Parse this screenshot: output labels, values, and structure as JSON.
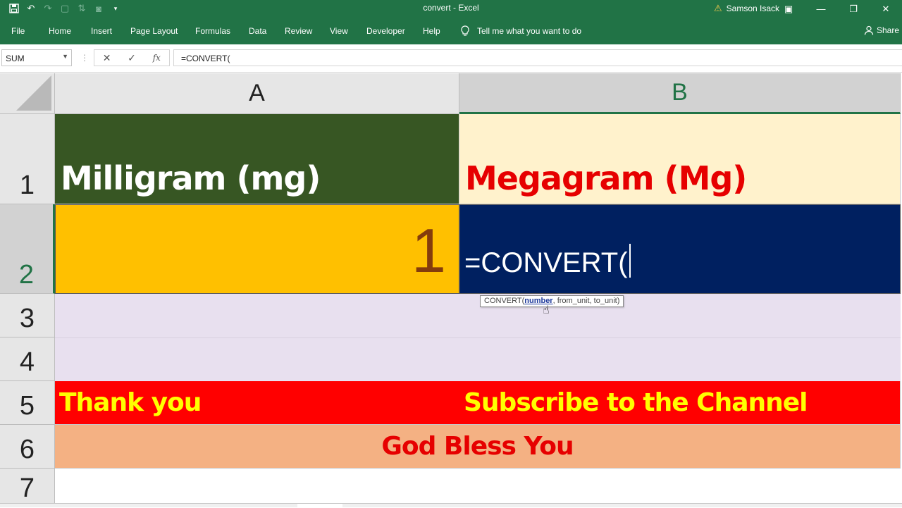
{
  "window": {
    "title": "convert  -  Excel",
    "user": "Samson Isack"
  },
  "qat_icons": [
    "save-icon",
    "undo-icon",
    "redo-icon",
    "new-file-icon",
    "sort-icon",
    "camera-icon",
    "customize-icon"
  ],
  "ribbon": {
    "tabs": [
      "File",
      "Home",
      "Insert",
      "Page Layout",
      "Formulas",
      "Data",
      "Review",
      "View",
      "Developer",
      "Help"
    ],
    "tell_me": "Tell me what you want to do",
    "share": "Share"
  },
  "formula_bar": {
    "name_box": "SUM",
    "cancel_symbol": "✕",
    "enter_symbol": "✓",
    "fx_label": "fx",
    "formula": "=CONVERT("
  },
  "columns": [
    "A",
    "B"
  ],
  "rows": [
    "1",
    "2",
    "3",
    "4",
    "5",
    "6",
    "7"
  ],
  "cells": {
    "A1": "Milligram (mg)",
    "B1": "Megagram (Mg)",
    "A2": "1",
    "B2": "=CONVERT(",
    "A5": "Thank you",
    "B5": "Subscribe to the Channel",
    "A6": "God Bless You"
  },
  "tooltip": {
    "func": "CONVERT(",
    "arg_active": "number",
    "rest": ", from_unit, to_unit)"
  },
  "colors": {
    "excel_green": "#217346",
    "a1_fill": "#375623",
    "b1_fill": "#fff2cc",
    "a2_fill": "#ffc000",
    "b2_fill": "#002060",
    "rows34_fill": "#e8e0ef",
    "row5_fill": "#ff0000",
    "row6_fill": "#f4b183"
  }
}
